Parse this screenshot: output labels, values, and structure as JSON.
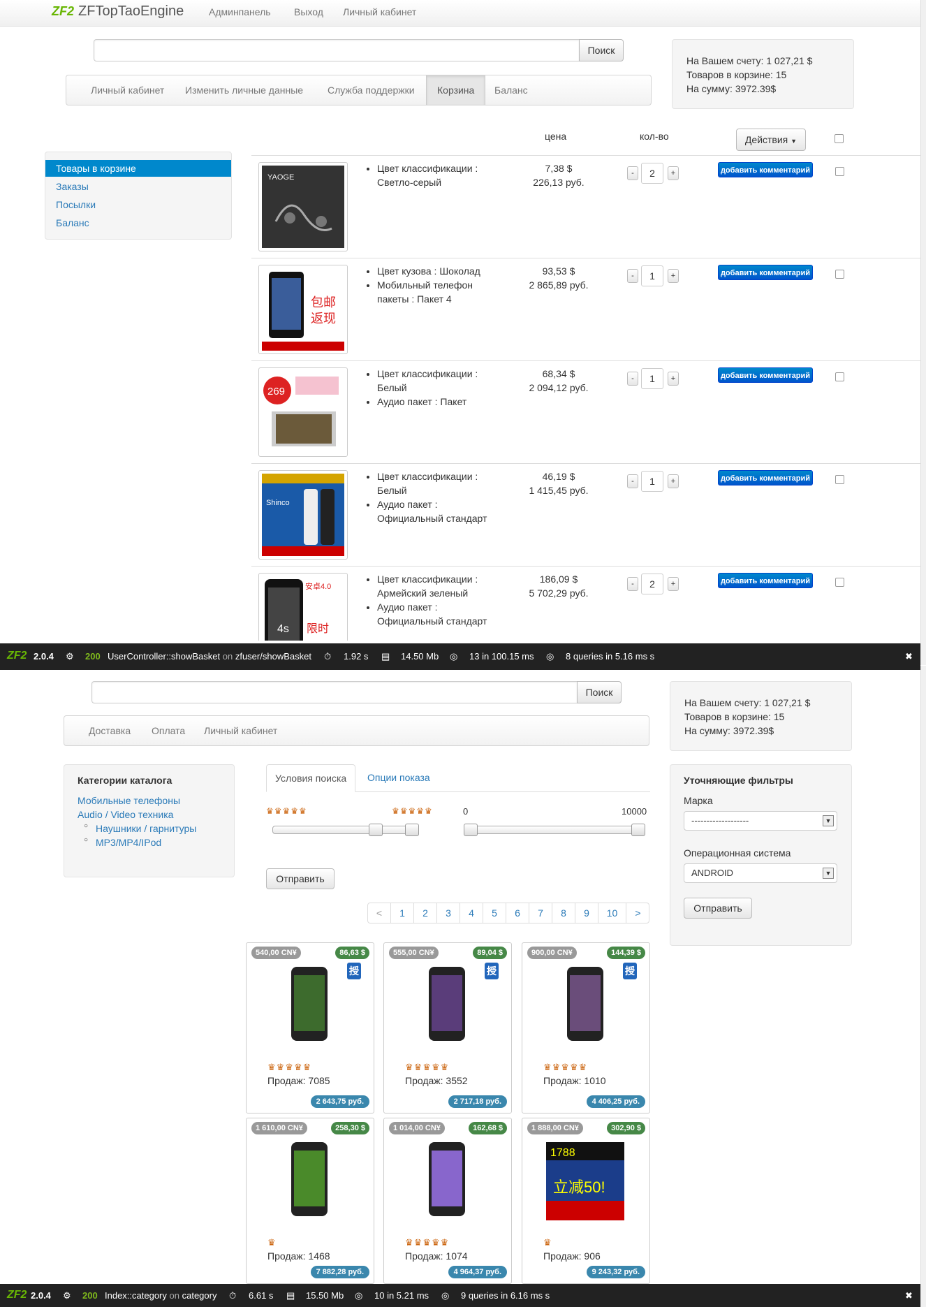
{
  "screen1": {
    "brand": "ZFTopTaoEngine",
    "brand_logo": "ZF2",
    "nav": [
      "Админпанель",
      "Выход",
      "Личный кабинет"
    ],
    "search_button": "Поиск",
    "account": {
      "balance": "На Вашем счету: 1 027,21 $",
      "items": "Товаров в корзине: 15",
      "sum": "На сумму: 3972.39$"
    },
    "tabs": [
      "Личный кабинет",
      "Изменить личные данные",
      "Служба поддержки",
      "Корзина",
      "Баланс"
    ],
    "active_tab": "Корзина",
    "sidebar": [
      "Товары в корзине",
      "Заказы",
      "Посылки",
      "Баланс"
    ],
    "columns": {
      "price": "цена",
      "qty": "кол-во",
      "actions": "Действия"
    },
    "comment_button": "добавить комментарий",
    "rows": [
      {
        "attrs": [
          "Цвет классификации : Светло-серый"
        ],
        "usd": "7,38 $",
        "rub": "226,13 руб.",
        "qty": "2"
      },
      {
        "attrs": [
          "Цвет кузова : Шоколад",
          "Мобильный телефон пакеты : Пакет 4"
        ],
        "usd": "93,53 $",
        "rub": "2 865,89 руб.",
        "qty": "1"
      },
      {
        "attrs": [
          "Цвет классификации : Белый",
          "Аудио пакет : Пакет"
        ],
        "usd": "68,34 $",
        "rub": "2 094,12 руб.",
        "qty": "1"
      },
      {
        "attrs": [
          "Цвет классификации : Белый",
          "Аудио пакет : Официальный стандарт"
        ],
        "usd": "46,19 $",
        "rub": "1 415,45 руб.",
        "qty": "1"
      },
      {
        "attrs": [
          "Цвет классификации : Армейский зеленый",
          "Аудио пакет : Официальный стандарт"
        ],
        "usd": "186,09 $",
        "rub": "5 702,29 руб.",
        "qty": "2"
      }
    ],
    "debug": {
      "version": "2.0.4",
      "status": "200",
      "controller": "UserController::showBasket",
      "on": "on",
      "route": "zfuser/showBasket",
      "time": "1.92 s",
      "memory": "14.50 Mb",
      "db": "13 in 100.15 ms",
      "queries": "8 queries in 5.16 ms s"
    }
  },
  "screen2": {
    "search_button": "Поиск",
    "account": {
      "balance": "На Вашем счету: 1 027,21 $",
      "items": "Товаров в корзине: 15",
      "sum": "На сумму: 3972.39$"
    },
    "nav": [
      "Доставка",
      "Оплата",
      "Личный кабинет"
    ],
    "categories_title": "Категории каталога",
    "categories": [
      "Мобильные телефоны",
      "Audio / Video техника"
    ],
    "subcategories": [
      "Наушники / гарнитуры",
      "MP3/MP4/IPod"
    ],
    "tabs": [
      "Условия поиска",
      "Опции показа"
    ],
    "range_min": "0",
    "range_max": "10000",
    "submit": "Отправить",
    "pager": [
      "<",
      "1",
      "2",
      "3",
      "4",
      "5",
      "6",
      "7",
      "8",
      "9",
      "10",
      ">"
    ],
    "filters": {
      "title": "Уточняющие фильтры",
      "brand_label": "Марка",
      "brand_value": "-------------------",
      "os_label": "Операционная система",
      "os_value": "ANDROID",
      "submit": "Отправить"
    },
    "auth_glyph": "授",
    "products": [
      {
        "cny": "540,00 CN¥",
        "usd": "86,63 $",
        "sales": "Продаж: 7085",
        "rub": "2 643,75 руб.",
        "crowns": "♛♛♛♛♛"
      },
      {
        "cny": "555,00 CN¥",
        "usd": "89,04 $",
        "sales": "Продаж: 3552",
        "rub": "2 717,18 руб.",
        "crowns": "♛♛♛♛♛"
      },
      {
        "cny": "900,00 CN¥",
        "usd": "144,39 $",
        "sales": "Продаж: 1010",
        "rub": "4 406,25 руб.",
        "crowns": "♛♛♛♛♛"
      },
      {
        "cny": "1 610,00 CN¥",
        "usd": "258,30 $",
        "sales": "Продаж: 1468",
        "rub": "7 882,28 руб.",
        "crowns": "♛"
      },
      {
        "cny": "1 014,00 CN¥",
        "usd": "162,68 $",
        "sales": "Продаж: 1074",
        "rub": "4 964,37 руб.",
        "crowns": "♛♛♛♛♛"
      },
      {
        "cny": "1 888,00 CN¥",
        "usd": "302,90 $",
        "sales": "Продаж: 906",
        "rub": "9 243,32 руб.",
        "crowns": "♛"
      }
    ],
    "debug": {
      "version": "2.0.4",
      "status": "200",
      "controller": "Index::category",
      "on": "on",
      "route": "category",
      "time": "6.61 s",
      "memory": "15.50 Mb",
      "db": "10 in 5.21 ms",
      "queries": "9 queries in 6.16 ms s"
    }
  },
  "icons": {
    "gear": "gear-icon",
    "clock": "stopwatch-icon",
    "memory": "memory-icon",
    "db": "database-icon",
    "close": "close-icon"
  }
}
